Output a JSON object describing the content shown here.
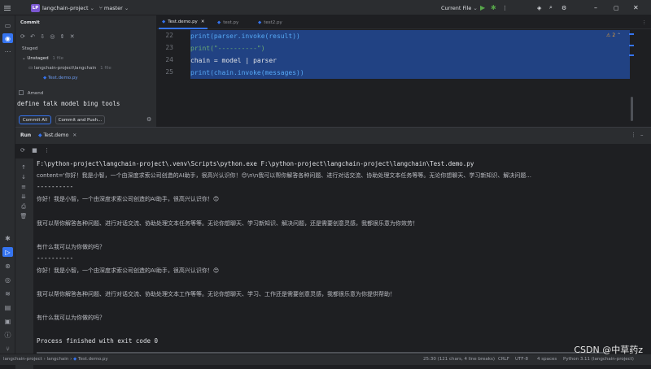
{
  "titlebar": {
    "project_badge": "LP",
    "project_name": "langchain-project",
    "branch": "master",
    "run_config": "Current File"
  },
  "commit_panel": {
    "title": "Commit",
    "staged_label": "Staged",
    "unstaged_label": "Unstaged",
    "unstaged_count": "1 file",
    "tree_folder": "langchain-project\\langchain",
    "tree_folder_count": "1 file",
    "tree_file": "Test.demo.py",
    "amend_label": "Amend",
    "commit_message": "define talk model bing tools",
    "commit_all_button": "Commit All",
    "commit_push_button": "Commit and Push..."
  },
  "editor": {
    "tabs": [
      {
        "label": "Test.demo.py",
        "active": true
      },
      {
        "label": "test.py",
        "active": false
      },
      {
        "label": "test2.py",
        "active": false
      }
    ],
    "inspection_badge": "2",
    "lines": [
      {
        "num": "22",
        "text": "print(parser.invoke(result))"
      },
      {
        "num": "23",
        "text": "print(\"----------\")"
      },
      {
        "num": "24",
        "text": "chain = model | parser"
      },
      {
        "num": "25",
        "text": "print(chain.invoke(messages))"
      }
    ]
  },
  "run_panel": {
    "label": "Run",
    "tab": "Test.demo",
    "output": [
      "F:\\python-project\\langchain-project\\.venv\\Scripts\\python.exe F:\\python-project\\langchain-project\\langchain\\Test.demo.py",
      "content='你好！我是小智，一个由深度求索公司创造的AI助手，很高兴认识你！😊\\n\\n我可以帮你解答各种问题、进行对话交流、协助处理文本任务等等。无论你想聊天、学习新知识、解决问题...",
      "----------",
      "你好！我是小智，一个由深度求索公司创造的AI助手，很高兴认识你！😊",
      "",
      "我可以帮你解答各种问题、进行对话交流、协助处理文本任务等等。无论你想聊天、学习新知识、解决问题，还是需要创意灵感，我都很乐意为你效劳！",
      "",
      "有什么我可以为你做的吗？",
      "----------",
      "你好！我是小智，一个由深度求索公司创造的AI助手，很高兴认识你！😊",
      "",
      "我可以帮你解答各种问题、进行对话交流、协助处理文本工作等等。无论你想聊天、学习、工作还是需要创意灵感，我都很乐意为你提供帮助！",
      "",
      "有什么我可以为你做的吗？",
      "",
      "Process finished with exit code 0"
    ]
  },
  "statusbar": {
    "breadcrumb_1": "langchain-project",
    "breadcrumb_2": "langchain",
    "breadcrumb_3": "Test.demo.py",
    "position": "25:30 (121 chars, 4 line breaks)",
    "line_sep": "CRLF",
    "encoding": "UTF-8",
    "indent": "4 spaces",
    "interpreter": "Python 3.11 (langchain-project)"
  },
  "watermark": "CSDN @中草药z",
  "colors": {
    "accent": "#3574f0",
    "selection": "#214283",
    "badge": "#7b57d1"
  }
}
